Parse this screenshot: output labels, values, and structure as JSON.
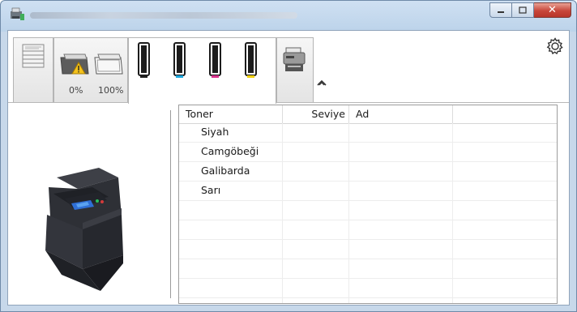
{
  "window": {
    "controls": {
      "minimize": "minimize-icon",
      "maximize": "maximize-icon",
      "close": "close-icon"
    }
  },
  "toolbar": {
    "paper_levels": [
      "0%",
      "100%"
    ],
    "toner_colors": [
      "#1e1e1e",
      "#1aa7de",
      "#d8318c",
      "#f2d20e"
    ],
    "icons": [
      "pages-icon",
      "paper-tray-warning-icon",
      "paper-tray-icon",
      "toner-cartridge-icon",
      "device-icon",
      "settings-gear-icon",
      "collapse-chevron-icon"
    ]
  },
  "table": {
    "columns": [
      "Toner",
      "Seviye",
      "Ad",
      ""
    ],
    "rows": [
      {
        "toner": "Siyah",
        "level": "",
        "name": ""
      },
      {
        "toner": "Camgöbeği",
        "level": "",
        "name": ""
      },
      {
        "toner": "Galibarda",
        "level": "",
        "name": ""
      },
      {
        "toner": "Sarı",
        "level": "",
        "name": ""
      },
      {
        "toner": "",
        "level": "",
        "name": ""
      },
      {
        "toner": "",
        "level": "",
        "name": ""
      },
      {
        "toner": "",
        "level": "",
        "name": ""
      },
      {
        "toner": "",
        "level": "",
        "name": ""
      },
      {
        "toner": "",
        "level": "",
        "name": ""
      },
      {
        "toner": "",
        "level": "",
        "name": ""
      }
    ]
  }
}
